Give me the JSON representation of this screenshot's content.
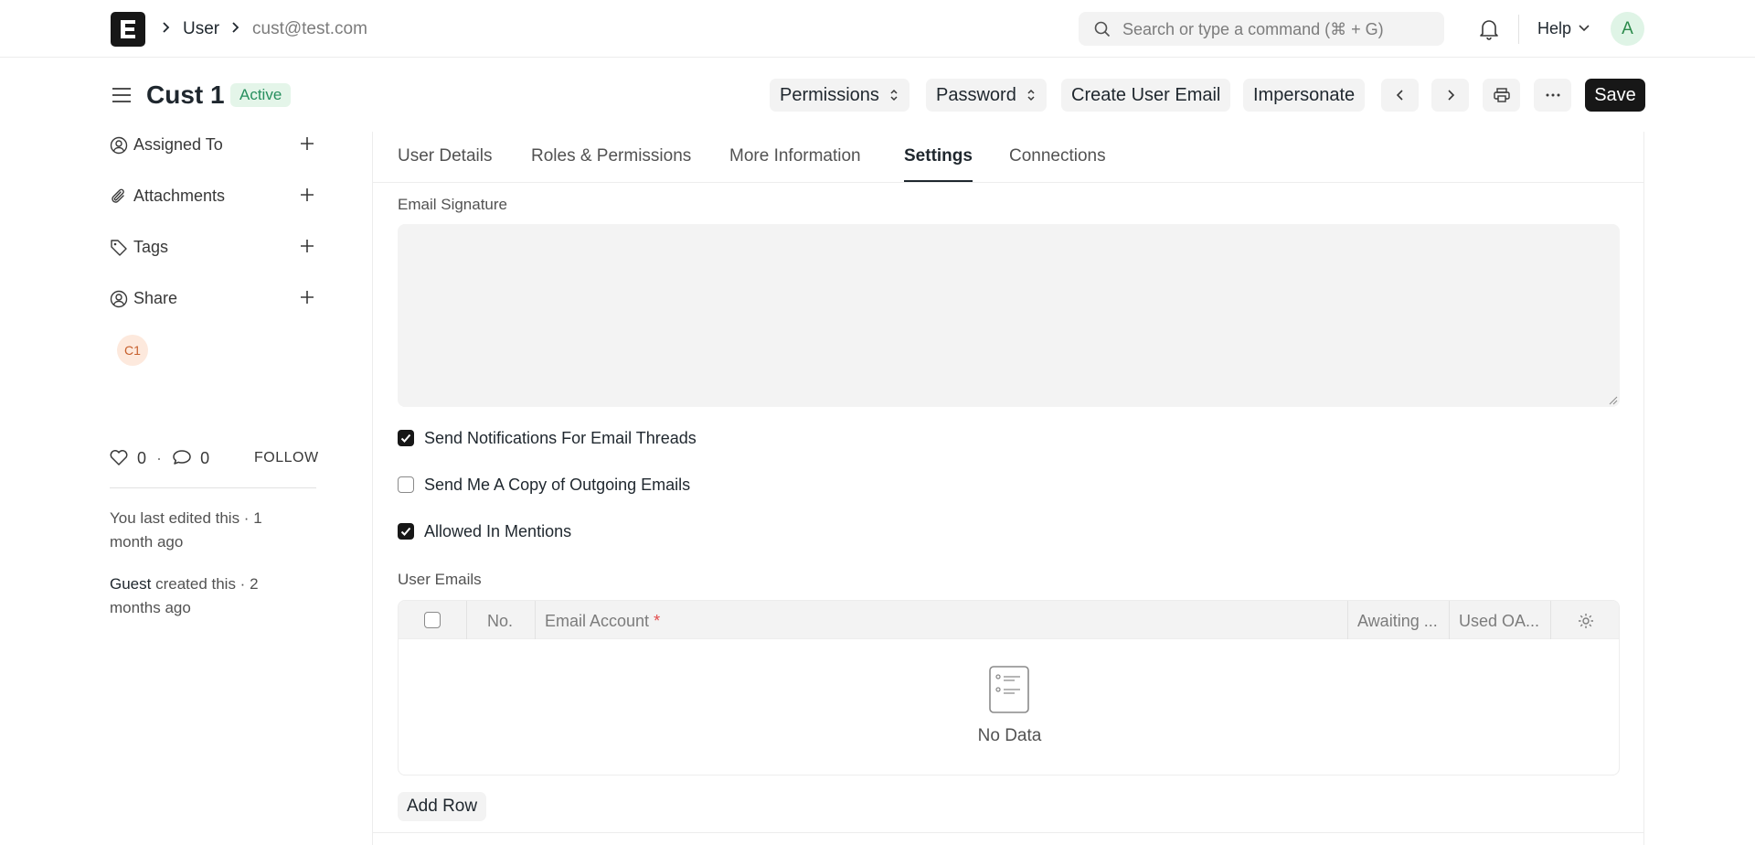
{
  "navbar": {
    "breadcrumbs": [
      "User",
      "cust@test.com"
    ],
    "search_placeholder": "Search or type a command (⌘ + G)",
    "help_label": "Help",
    "avatar_initial": "A"
  },
  "header": {
    "title": "Cust 1",
    "status": "Active",
    "buttons": {
      "permissions": "Permissions",
      "password": "Password",
      "create_user_email": "Create User Email",
      "impersonate": "Impersonate",
      "save": "Save"
    }
  },
  "sidebar": {
    "items": [
      {
        "label": "Assigned To",
        "icon": "assign-icon"
      },
      {
        "label": "Attachments",
        "icon": "paperclip-icon"
      },
      {
        "label": "Tags",
        "icon": "tag-icon"
      },
      {
        "label": "Share",
        "icon": "share-icon"
      }
    ],
    "shared_with_initials": "C1",
    "likes": "0",
    "comments": "0",
    "follow_label": "FOLLOW",
    "last_edited": "You last edited this · 1 month ago",
    "created_by": "Guest",
    "created_text": " created this · 2 months ago"
  },
  "tabs": [
    "User Details",
    "Roles & Permissions",
    "More Information",
    "Settings",
    "Connections"
  ],
  "active_tab": "Settings",
  "form": {
    "email_signature_label": "Email Signature",
    "email_signature_value": "",
    "checkboxes": [
      {
        "label": "Send Notifications For Email Threads",
        "checked": true
      },
      {
        "label": "Send Me A Copy of Outgoing Emails",
        "checked": false
      },
      {
        "label": "Allowed In Mentions",
        "checked": true
      }
    ],
    "user_emails_label": "User Emails",
    "table": {
      "columns": [
        "No.",
        "Email Account",
        "Awaiting ...",
        "Used OA..."
      ],
      "required_marker": "*",
      "empty_text": "No Data",
      "rows": []
    },
    "add_row_label": "Add Row"
  },
  "colors": {
    "accent": "#171717",
    "active_badge_bg": "#e4f5e9",
    "active_badge_text": "#278f5e",
    "required": "#e24c4c"
  }
}
